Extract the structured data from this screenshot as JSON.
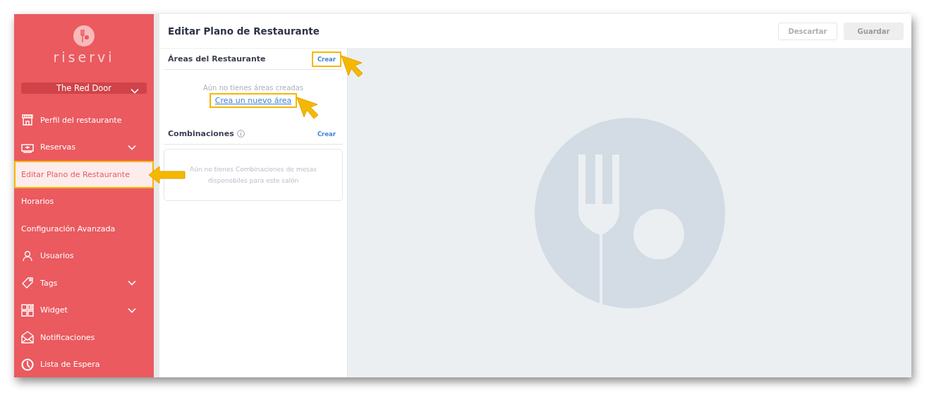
{
  "sidebar": {
    "brand": "riservi",
    "restaurant_selector": "The Red Door",
    "items": [
      {
        "label": "Perfil del restaurante",
        "selected": false,
        "expandable": false,
        "highlighted": false
      },
      {
        "label": "Reservas",
        "selected": false,
        "expandable": true,
        "highlighted": false
      },
      {
        "label": "Editar Plano de Restaurante",
        "selected": true,
        "expandable": false,
        "highlighted": true
      },
      {
        "label": "Horarios",
        "selected": false,
        "expandable": false,
        "highlighted": false
      },
      {
        "label": "Configuración Avanzada",
        "selected": false,
        "expandable": false,
        "highlighted": false
      },
      {
        "label": "Usuarios",
        "selected": false,
        "expandable": false,
        "highlighted": false
      },
      {
        "label": "Tags",
        "selected": false,
        "expandable": true,
        "highlighted": false
      },
      {
        "label": "Widget",
        "selected": false,
        "expandable": true,
        "highlighted": false
      },
      {
        "label": "Notificaciones",
        "selected": false,
        "expandable": false,
        "highlighted": false
      },
      {
        "label": "Lista de Espera",
        "selected": false,
        "expandable": false,
        "highlighted": false
      }
    ]
  },
  "header": {
    "title": "Editar Plano de Restaurante",
    "buttons": [
      {
        "label": "Descartar",
        "disabled": false
      },
      {
        "label": "Guardar",
        "disabled": true
      }
    ]
  },
  "areas": {
    "title": "Áreas del Restaurante",
    "action": {
      "label": "Crear",
      "highlighted": true
    },
    "empty_text": "Aún no tienes áreas creadas",
    "link": {
      "label": "Crea un nuevo área",
      "highlighted": true
    }
  },
  "combinations": {
    "title": "Combinaciones",
    "action": {
      "label": "Crear",
      "highlighted": false
    },
    "empty_text": "Aún no tienes Combinaciones de mesas disponobiles para este salón"
  }
}
